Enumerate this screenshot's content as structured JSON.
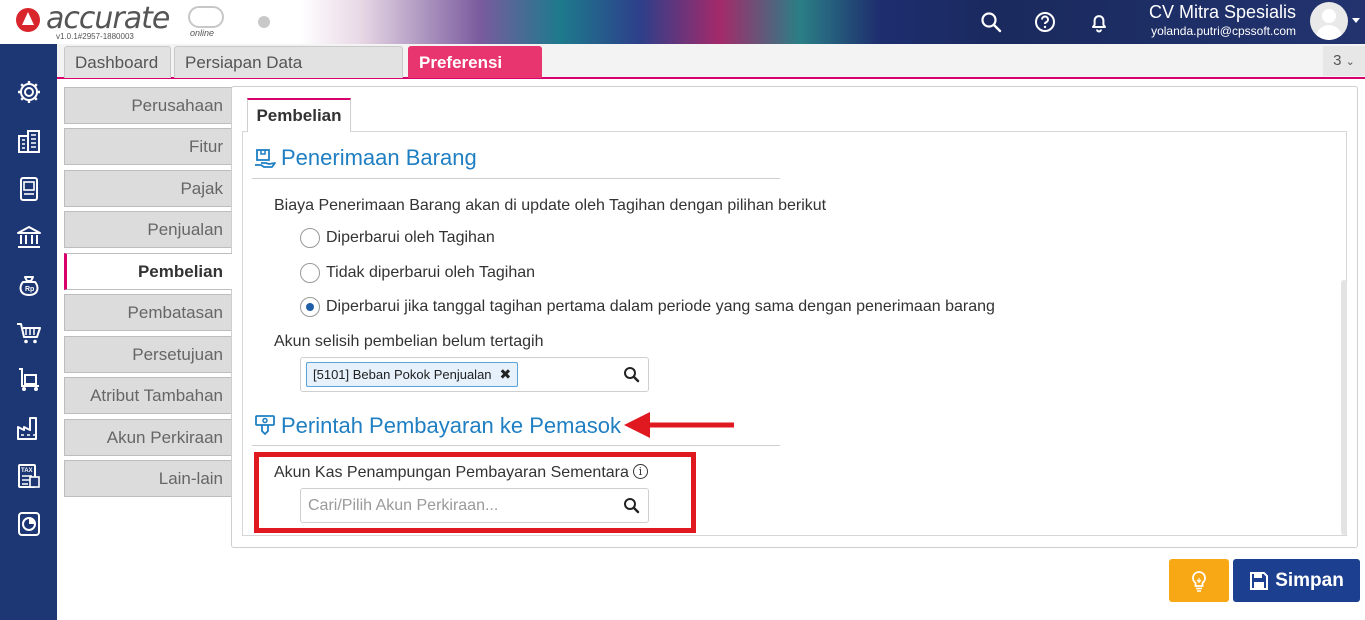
{
  "app": {
    "logo_text": "accurate",
    "logo_suffix": "online",
    "version": "v1.0.1#2957-1880003"
  },
  "header": {
    "company_name": "CV Mitra Spesialis",
    "user_email": "yolanda.putri@cpssoft.com",
    "icons": [
      "search-icon",
      "help-icon",
      "bell-icon"
    ]
  },
  "leftbar": {
    "icons": [
      "settings-icon",
      "building-icon",
      "book-icon",
      "bank-icon",
      "money-bag-icon",
      "cart-icon",
      "trolley-icon",
      "factory-icon",
      "tax-icon",
      "report-icon"
    ]
  },
  "tabs": [
    {
      "label": "Dashboard"
    },
    {
      "label": "Persiapan Data Perusahaan"
    },
    {
      "label": "Preferensi",
      "close": "✖"
    }
  ],
  "tab_count": "3",
  "side_menu": [
    {
      "label": "Perusahaan"
    },
    {
      "label": "Fitur"
    },
    {
      "label": "Pajak"
    },
    {
      "label": "Penjualan"
    },
    {
      "label": "Pembelian"
    },
    {
      "label": "Pembatasan"
    },
    {
      "label": "Persetujuan"
    },
    {
      "label": "Atribut Tambahan"
    },
    {
      "label": "Akun Perkiraan"
    },
    {
      "label": "Lain-lain"
    }
  ],
  "content": {
    "subtab": "Pembelian",
    "section1": {
      "title": "Penerimaan Barang",
      "question": "Biaya Penerimaan Barang akan di update oleh Tagihan dengan pilihan berikut",
      "options": [
        {
          "label": "Diperbarui oleh Tagihan",
          "checked": false
        },
        {
          "label": "Tidak diperbarui oleh Tagihan",
          "checked": false
        },
        {
          "label": "Diperbarui jika tanggal tagihan pertama dalam periode yang sama dengan penerimaan barang",
          "checked": true
        }
      ],
      "account_label": "Akun selisih pembelian belum tertagih",
      "account_value": "[5101] Beban Pokok Penjualan",
      "chip_remove": "✖"
    },
    "section2": {
      "title": "Perintah Pembayaran ke Pemasok",
      "field_label": "Akun Kas Penampungan Pembayaran Sementara",
      "info": "i",
      "field_placeholder": "Cari/Pilih Akun Perkiraan..."
    }
  },
  "buttons": {
    "save_label": "Simpan"
  },
  "colors": {
    "accent": "#d8006a",
    "active_tab": "#e8356f",
    "sidebar": "#1d3774",
    "section_title": "#1f7fc2",
    "save_button": "#1d3f8f",
    "tip_button": "#f9a815",
    "annotation": "#e0181f"
  }
}
